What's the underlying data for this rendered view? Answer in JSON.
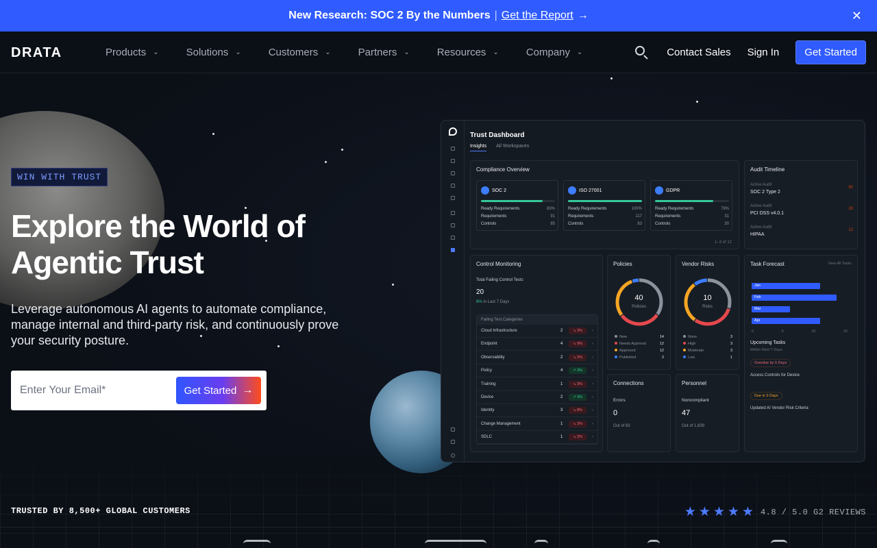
{
  "announcement": {
    "headline": "New Research: SOC 2 By the Numbers",
    "separator": "|",
    "link": "Get the Report",
    "arrow": "→",
    "close": "✕"
  },
  "nav": {
    "logo": "DRATA",
    "menu": [
      {
        "label": "Products"
      },
      {
        "label": "Solutions"
      },
      {
        "label": "Customers"
      },
      {
        "label": "Partners"
      },
      {
        "label": "Resources"
      },
      {
        "label": "Company"
      }
    ],
    "contact_sales": "Contact Sales",
    "sign_in": "Sign In",
    "get_started": "Get Started"
  },
  "hero": {
    "badge": "WIN WITH TRUST",
    "headline": "Explore the World of Agentic Trust",
    "subhead": "Leverage autonomous AI agents to automate compliance, manage internal and third-party risk, and continuously prove your security posture.",
    "email_placeholder": "Enter Your Email*",
    "cta": "Get Started",
    "cta_arrow": "→"
  },
  "dashboard": {
    "title": "Trust Dashboard",
    "tabs": [
      "Insights",
      "All Workspaces"
    ],
    "compliance": {
      "title": "Compliance Overview",
      "frameworks": [
        {
          "name": "SOC 2",
          "progress": 0.83,
          "ready": "83%",
          "requirements": "91",
          "controls": "85"
        },
        {
          "name": "ISO 27001",
          "progress": 1.0,
          "ready": "100%",
          "requirements": "117",
          "controls": "83"
        },
        {
          "name": "GDPR",
          "progress": 0.79,
          "ready": "79%",
          "requirements": "31",
          "controls": "30"
        }
      ],
      "row_labels": [
        "Ready Requirements",
        "Requirements",
        "Controls"
      ],
      "pager": "1–3 of 12"
    },
    "audit": {
      "title": "Audit Timeline",
      "label": "Active Audit",
      "items": [
        {
          "name": "SOC 2 Type 2",
          "tag": "90"
        },
        {
          "name": "PCI DSS v4.0.1",
          "tag": "28"
        },
        {
          "name": "HIPAA",
          "tag": "12"
        }
      ]
    },
    "control_monitoring": {
      "title": "Control Monitoring",
      "subtitle": "Total Failing Control Tests",
      "total": "20",
      "trend_value": "8%",
      "trend_label": "in Last 7 Days",
      "categories_title": "Failing Test Categories",
      "categories": [
        {
          "name": "Cloud Infrastructure",
          "count": "2",
          "change": "3%",
          "dir": "down"
        },
        {
          "name": "Endpoint",
          "count": "4",
          "change": "9%",
          "dir": "down"
        },
        {
          "name": "Observability",
          "count": "2",
          "change": "2%",
          "dir": "down"
        },
        {
          "name": "Policy",
          "count": "4",
          "change": "3%",
          "dir": "up"
        },
        {
          "name": "Training",
          "count": "1",
          "change": "3%",
          "dir": "down"
        },
        {
          "name": "Device",
          "count": "2",
          "change": "3%",
          "dir": "up"
        },
        {
          "name": "Identity",
          "count": "3",
          "change": "8%",
          "dir": "down"
        },
        {
          "name": "Change Management",
          "count": "1",
          "change": "2%",
          "dir": "down"
        },
        {
          "name": "SDLC",
          "count": "1",
          "change": "2%",
          "dir": "down"
        }
      ]
    },
    "policies": {
      "title": "Policies",
      "value": "40",
      "label": "Policies",
      "legend": [
        {
          "name": "New",
          "count": "14",
          "color": "#8b929c"
        },
        {
          "name": "Needs Approval",
          "count": "12",
          "color": "#e5484d"
        },
        {
          "name": "Approved",
          "count": "12",
          "color": "#f5a524"
        },
        {
          "name": "Published",
          "count": "2",
          "color": "#3d7dff"
        }
      ]
    },
    "vendor_risks": {
      "title": "Vendor Risks",
      "value": "10",
      "label": "Risks",
      "legend": [
        {
          "name": "None",
          "count": "3",
          "color": "#8b929c"
        },
        {
          "name": "High",
          "count": "3",
          "color": "#e5484d"
        },
        {
          "name": "Moderate",
          "count": "3",
          "color": "#f5a524"
        },
        {
          "name": "Low",
          "count": "1",
          "color": "#3d7dff"
        }
      ]
    },
    "task_forecast": {
      "title": "Task Forecast",
      "view_all": "View All Tasks",
      "months": [
        "Jan",
        "Feb",
        "Mar",
        "Apr"
      ],
      "axis": [
        "0",
        "5",
        "10",
        "15"
      ],
      "upcoming": "Upcoming Tasks",
      "upcoming_sub": "Within Next 7 Days",
      "pill1": "Overdue by 5 Days",
      "task1": "Access Controls for Device",
      "pill2": "Due in 3 Days",
      "task2": "Updated AI Vendor Risk Criteria"
    },
    "connections": {
      "title": "Connections",
      "label": "Errors",
      "value": "0",
      "sub": "Out of 83"
    },
    "personnel": {
      "title": "Personnel",
      "label": "Noncompliant",
      "value": "47",
      "sub": "Out of 1,839"
    }
  },
  "footer_strip": {
    "trusted": "TRUSTED BY 8,500+ GLOBAL CUSTOMERS",
    "stars": "★★★★★",
    "rating": "4.8 / 5.0 G2 REVIEWS"
  },
  "colors": {
    "accent": "#2f5bff",
    "background": "#0b0f16",
    "star": "#4d7bff"
  }
}
